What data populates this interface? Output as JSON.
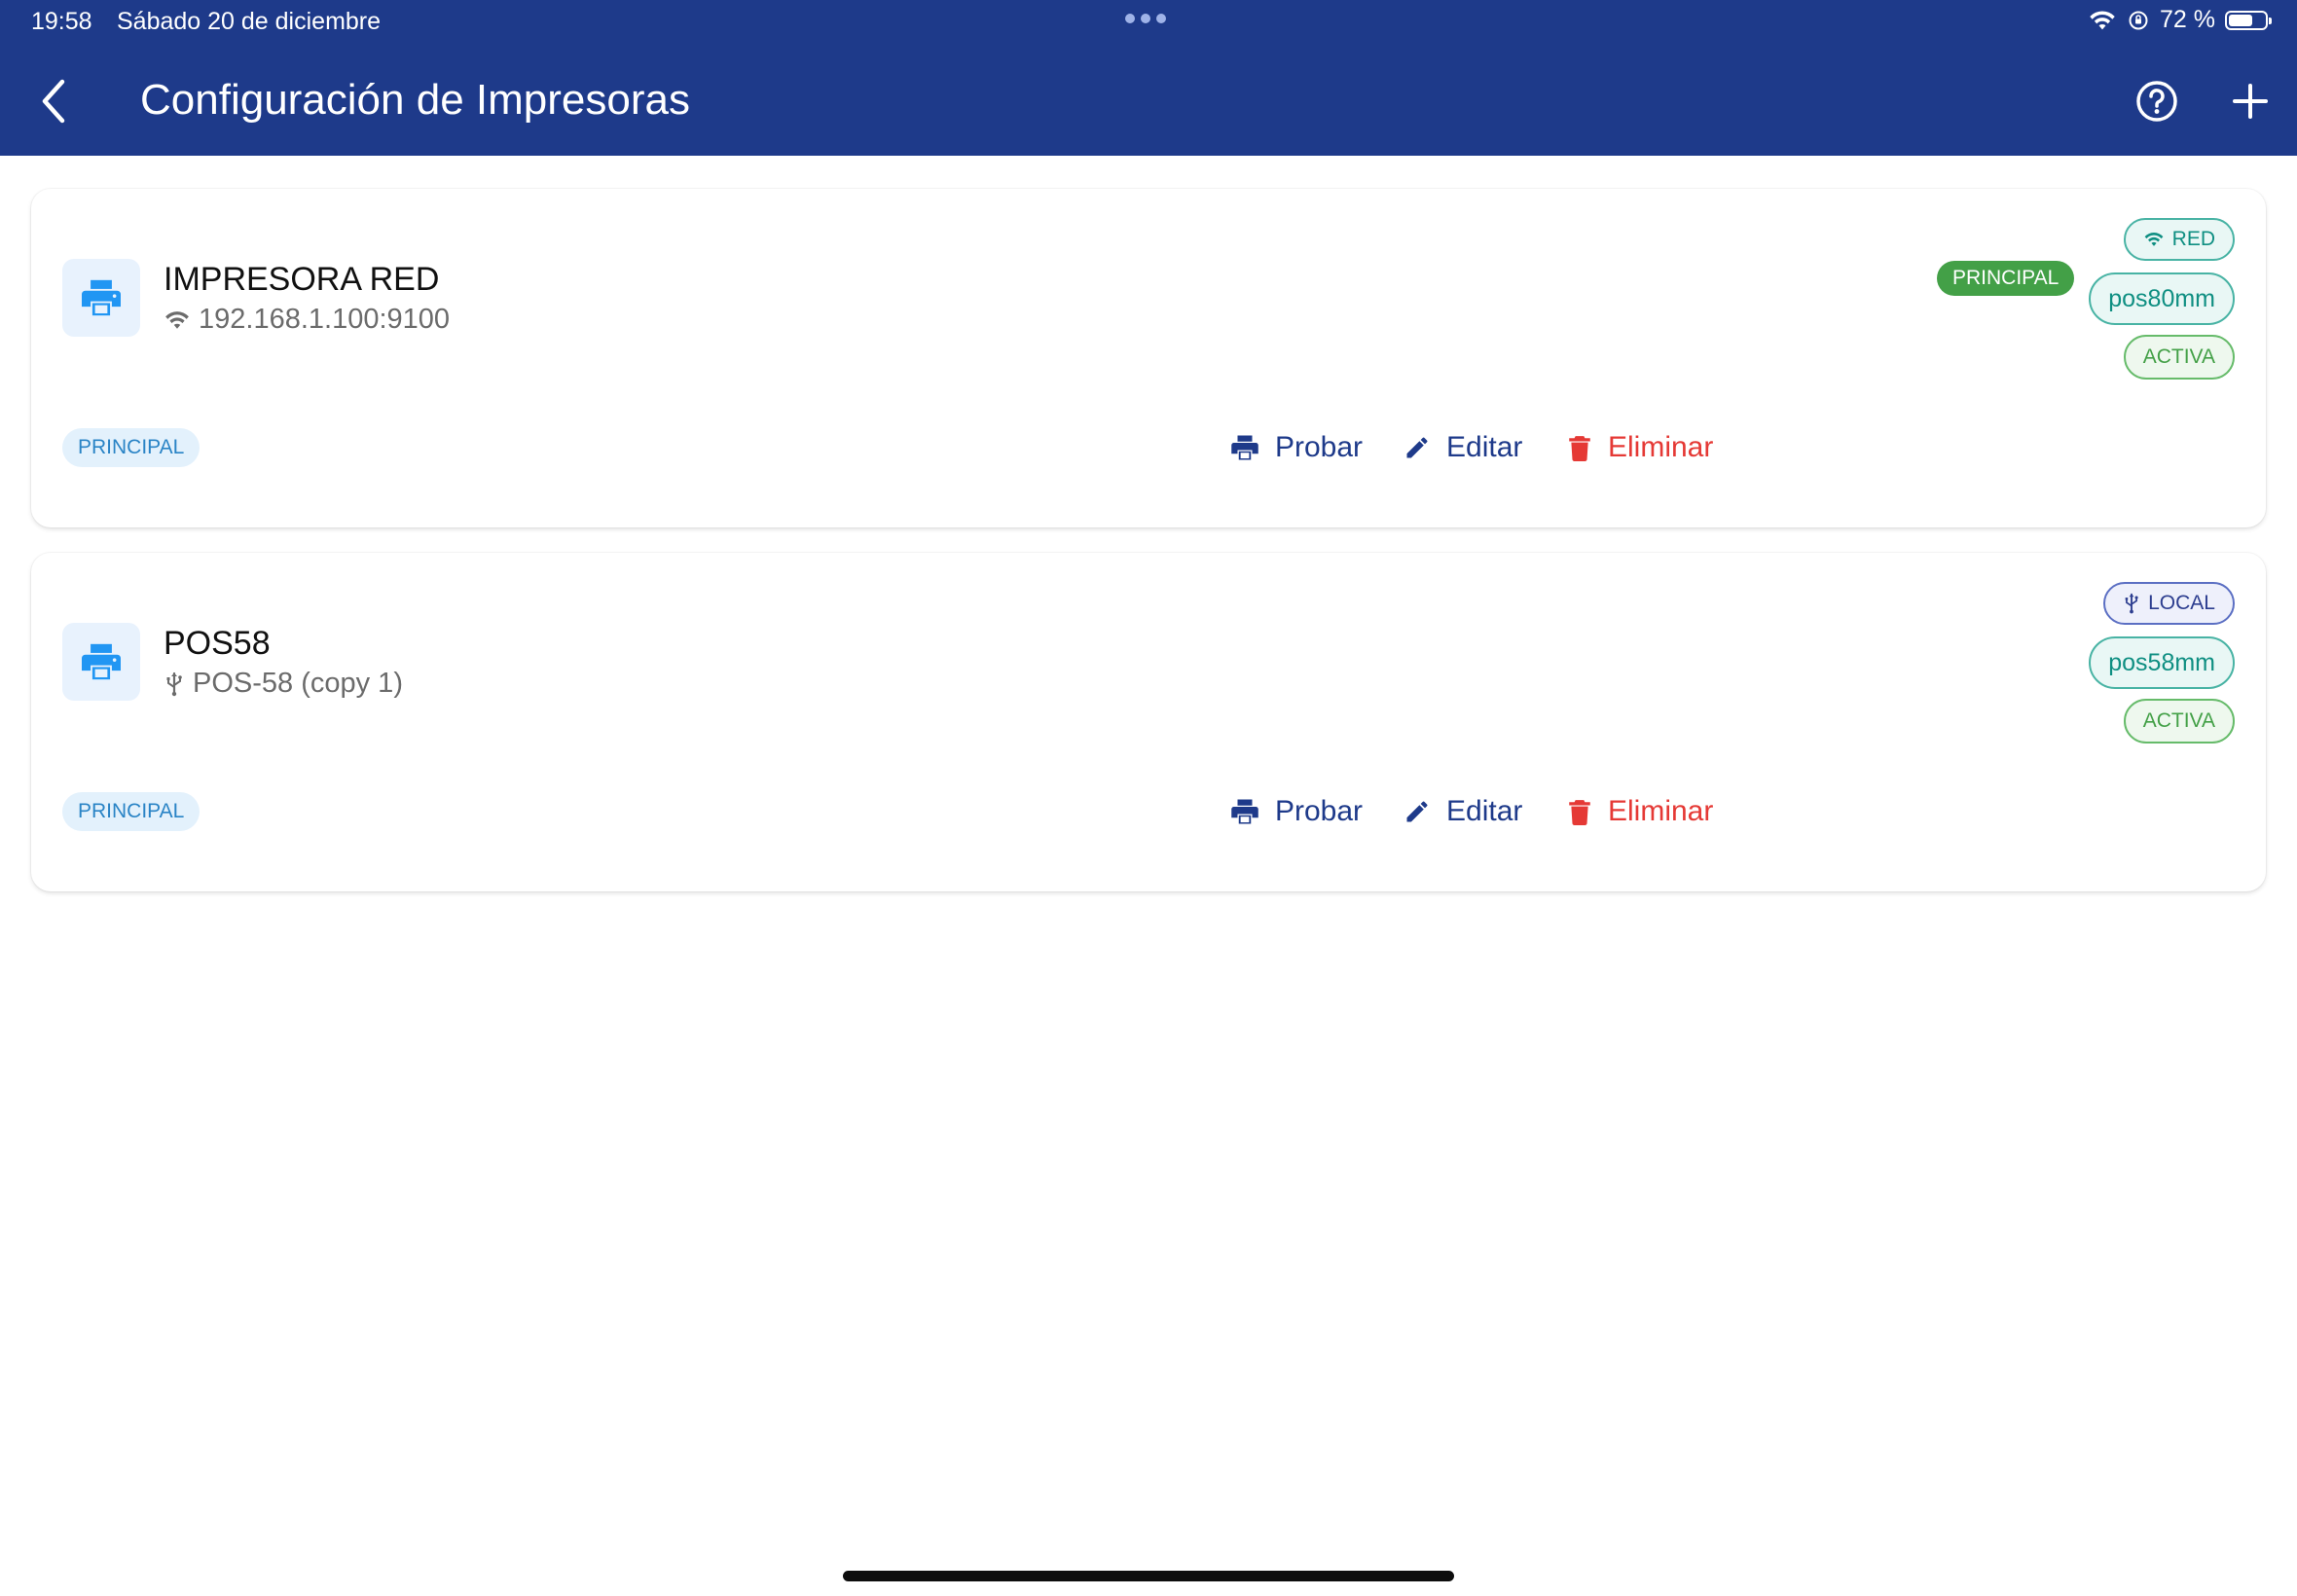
{
  "status_bar": {
    "time": "19:58",
    "date": "Sábado 20 de diciembre",
    "battery": "72 %",
    "battery_level": 0.72
  },
  "header": {
    "title": "Configuración de Impresoras",
    "back_icon": "chevron-left-icon",
    "help_icon": "help-circle-icon",
    "add_icon": "plus-icon"
  },
  "colors": {
    "appbar": "#1e3a8a",
    "accent_blue": "#1e3a8a",
    "delete_red": "#e53935",
    "success_green": "#43a047",
    "teal": "#0f8f82"
  },
  "printers": [
    {
      "name": "IMPRESORA RED",
      "address": "192.168.1.100:9100",
      "address_icon": "wifi-icon",
      "badge_principal": "PRINCIPAL",
      "connection": "RED",
      "paper": "pos80mm",
      "state": "ACTIVA",
      "role_chip": "PRINCIPAL"
    },
    {
      "name": "POS58",
      "address": "POS-58 (copy 1)",
      "address_icon": "usb-icon",
      "badge_principal": "",
      "connection": "LOCAL",
      "paper": "pos58mm",
      "state": "ACTIVA",
      "role_chip": "PRINCIPAL"
    }
  ],
  "actions": {
    "test": "Probar",
    "edit": "Editar",
    "delete": "Eliminar"
  }
}
